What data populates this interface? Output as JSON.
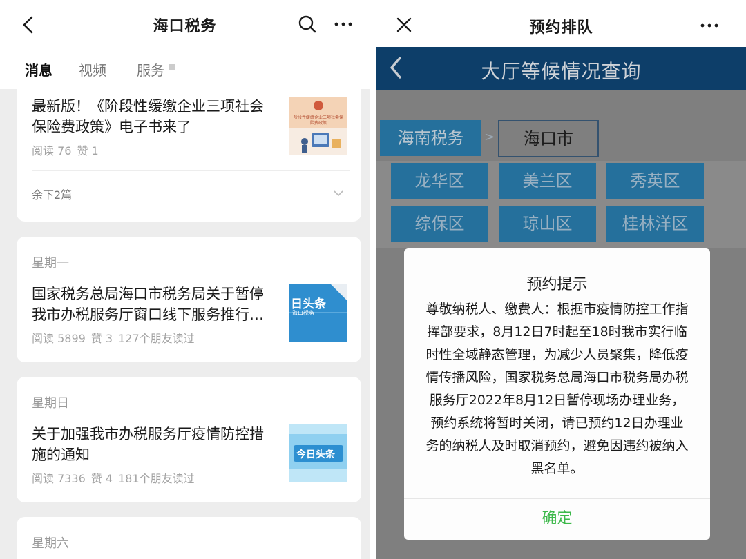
{
  "left": {
    "header": {
      "title": "海口税务",
      "back_icon": "chevron-left-icon",
      "search_icon": "search-icon",
      "more_icon": "more-horizontal-icon"
    },
    "tabs": [
      {
        "label": "消息",
        "active": true
      },
      {
        "label": "视频",
        "active": false
      },
      {
        "label": "服务",
        "active": false
      }
    ],
    "cards": [
      {
        "title": "最新版！《阶段性缓缴企业三项社会保险费政策》电子书来了",
        "reads": "阅读 76",
        "likes": "赞 1",
        "thumb_text": "阶段性缓缴企业三项社会保险费政策",
        "remain": "余下2篇"
      },
      {
        "day": "星期一",
        "title": "国家税务总局海口市税务局关于暂停我市办税服务厅窗口线下服务推行…",
        "reads": "阅读 5899",
        "likes": "赞 3",
        "friends": "127个朋友读过",
        "thumb_big": "日头条",
        "thumb_small": "海口税务"
      },
      {
        "day": "星期日",
        "title": "关于加强我市办税服务厅疫情防控措施的通知",
        "reads": "阅读 7336",
        "likes": "赞 4",
        "friends": "181个朋友读过",
        "thumb_big": "今日头条"
      },
      {
        "day": "星期六"
      }
    ]
  },
  "right": {
    "header": {
      "title": "预约排队",
      "close_icon": "close-icon",
      "more_icon": "more-horizontal-icon"
    },
    "web": {
      "title": "大厅等候情况查询",
      "crumb_province": "海南税务",
      "crumb_sep": ">",
      "crumb_city": "海口市",
      "districts": [
        "龙华区",
        "美兰区",
        "秀英区",
        "综保区",
        "琼山区",
        "桂林洋区"
      ]
    },
    "modal": {
      "title": "预约提示",
      "body": "尊敬纳税人、缴费人：根据市疫情防控工作指挥部要求，8月12日7时起至18时我市实行临时性全域静态管理，为减少人员聚集，降低疫情传播风险，国家税务总局海口市税务局办税服务厅2022年8月12日暂停现场办理业务，预约系统将暂时关闭，请已预约12日办理业务的纳税人及时取消预约，避免因违约被纳入黑名单。",
      "ok": "确定"
    }
  },
  "colors": {
    "web_bar": "#0d3e69",
    "district_btn": "#25709c",
    "overlay": "#7f7f7f",
    "ok_green": "#3cb84a"
  }
}
